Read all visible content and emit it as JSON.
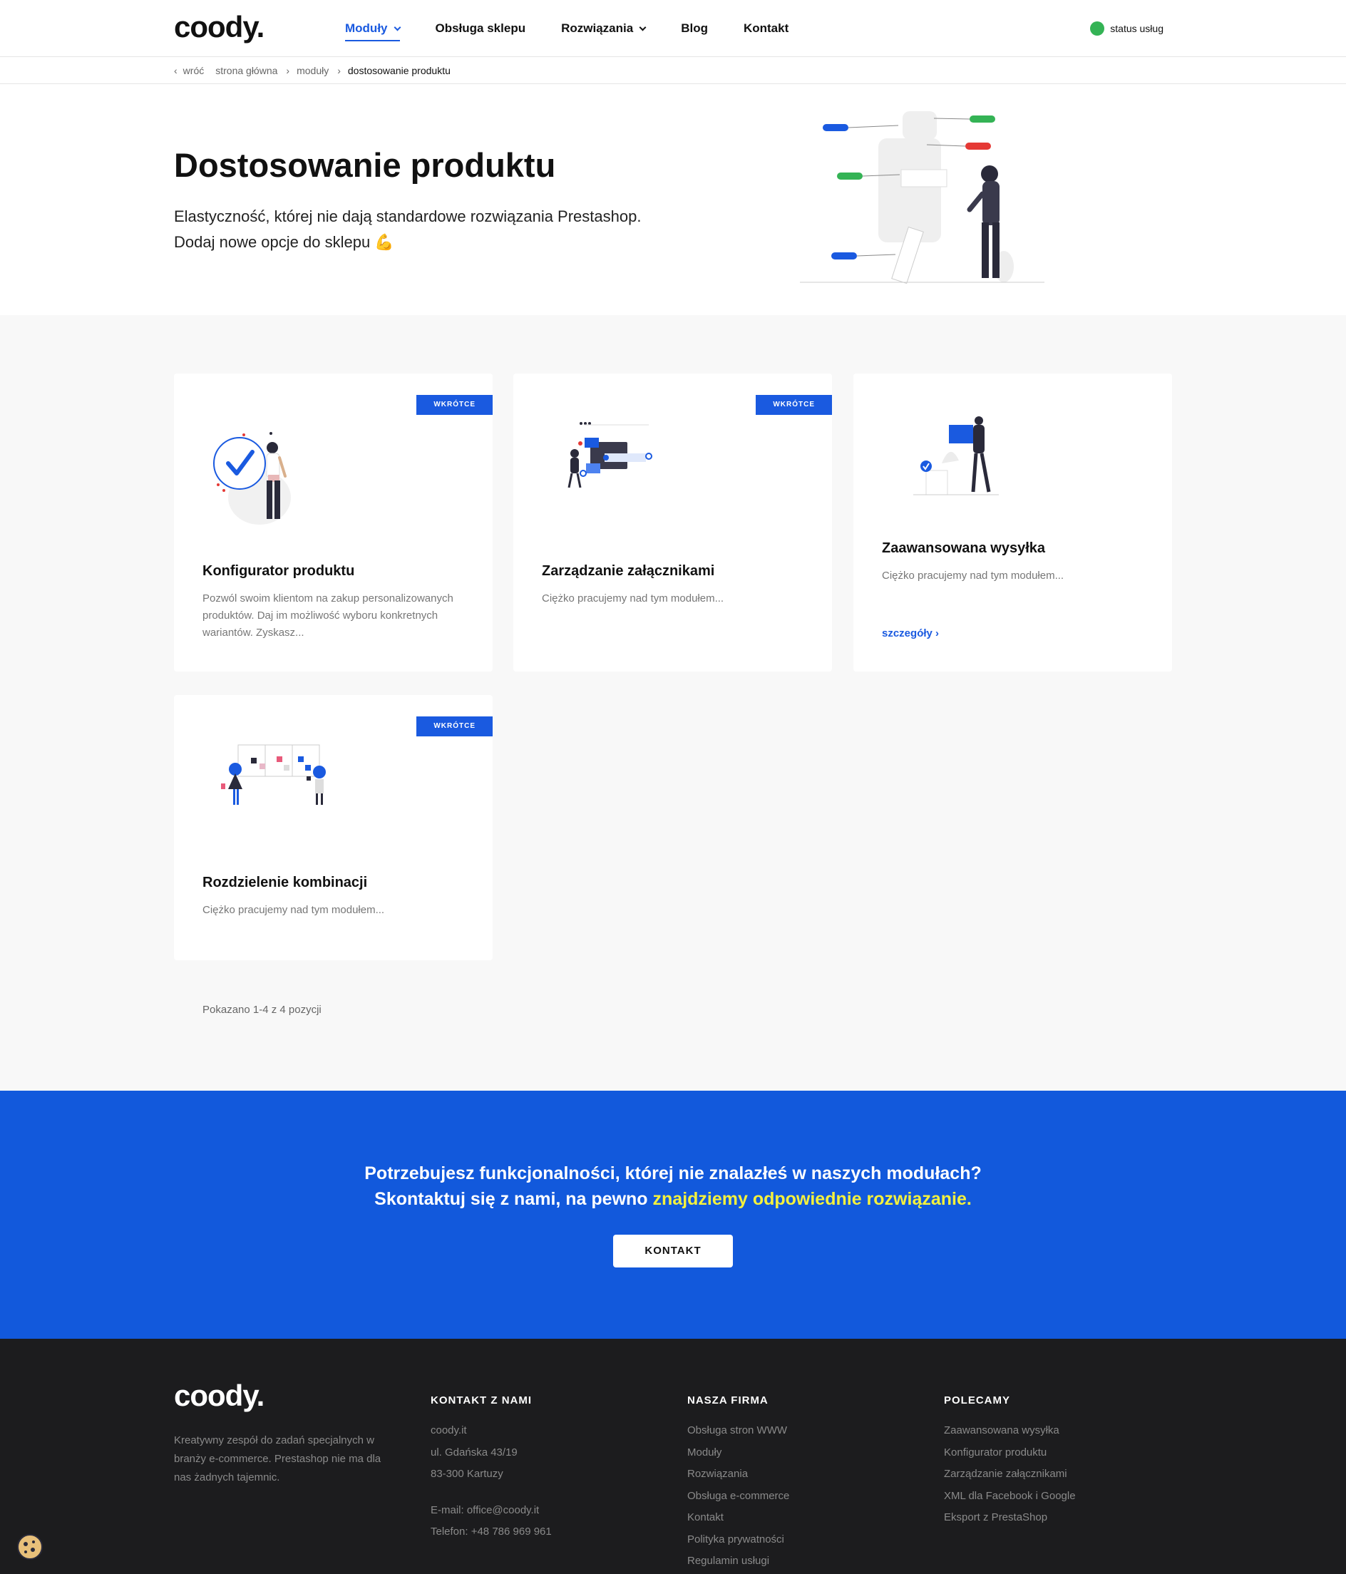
{
  "header": {
    "logo": "coody.",
    "nav": [
      {
        "label": "Moduły",
        "dropdown": true,
        "active": true
      },
      {
        "label": "Obsługa sklepu",
        "dropdown": false
      },
      {
        "label": "Rozwiązania",
        "dropdown": true
      },
      {
        "label": "Blog",
        "dropdown": false
      },
      {
        "label": "Kontakt",
        "dropdown": false
      }
    ],
    "status_label": "status usług",
    "status_color": "#34b355"
  },
  "breadcrumb": {
    "back": "wróć",
    "items": [
      "strona główna",
      "moduły",
      "dostosowanie produktu"
    ]
  },
  "hero": {
    "title": "Dostosowanie produktu",
    "subtitle_line1": "Elastyczność, której nie dają standardowe rozwiązania Prestashop.",
    "subtitle_line2": "Dodaj nowe opcje do sklepu",
    "emoji": "💪"
  },
  "modules": {
    "cards": [
      {
        "title": "Konfigurator produktu",
        "badge": "WKRÓTCE",
        "description": "Pozwól swoim klientom na zakup personalizowanych produktów. Daj im możliwość wyboru konkretnych wariantów. Zyskasz..."
      },
      {
        "title": "Zarządzanie załącznikami",
        "badge": "WKRÓTCE",
        "description": "Ciężko pracujemy nad tym modułem..."
      },
      {
        "title": "Zaawansowana wysyłka",
        "description": "Ciężko pracujemy nad tym modułem...",
        "link": "szczegóły"
      },
      {
        "title": "Rozdzielenie kombinacji",
        "badge": "WKRÓTCE",
        "description": "Ciężko pracujemy nad tym modułem..."
      }
    ],
    "shown": "Pokazano 1-4 z 4 pozycji"
  },
  "cta": {
    "line1": "Potrzebujesz funkcjonalności, której nie znalazłeś w naszych modułach?",
    "line2_prefix": "Skontaktuj się z nami, na pewno ",
    "line2_highlight": "znajdziemy odpowiednie rozwiązanie.",
    "button": "KONTAKT",
    "accent": "#1259dc",
    "highlight_color": "#f4f13d"
  },
  "footer": {
    "logo": "coody.",
    "about": "Kreatywny zespół do zadań specjalnych w branży e-commerce. Prestashop nie ma dla nas żadnych tajemnic.",
    "contact": {
      "heading": "KONTAKT Z NAMI",
      "lines": [
        "coody.it",
        "ul. Gdańska 43/19",
        "83-300 Kartuzy"
      ],
      "email": "E-mail: office@coody.it",
      "phone": "Telefon: +48 786 969 961"
    },
    "company": {
      "heading": "NASZA FIRMA",
      "links": [
        "Obsługa stron WWW",
        "Moduły",
        "Rozwiązania",
        "Obsługa e-commerce",
        "Kontakt",
        "Polityka prywatności",
        "Regulamin usługi"
      ]
    },
    "recommend": {
      "heading": "POLECAMY",
      "links": [
        "Zaawansowana wysyłka",
        "Konfigurator produktu",
        "Zarządzanie załącznikami",
        "XML dla Facebook i Google",
        "Eksport z PrestaShop"
      ]
    }
  }
}
